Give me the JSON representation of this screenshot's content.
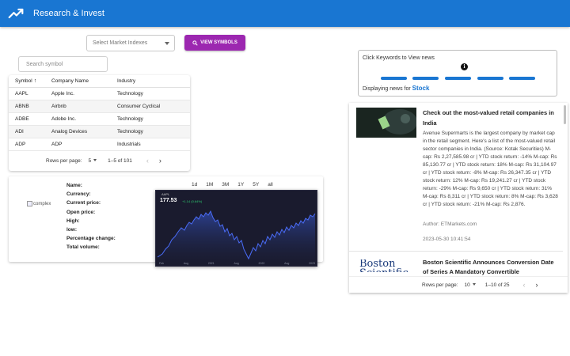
{
  "app": {
    "title": "Research & Invest",
    "brand_color": "#1976d2",
    "logo_icon": "trending-up-icon"
  },
  "controls": {
    "market_select_placeholder": "Select Market Indexes",
    "view_symbols_label": "VIEW SYMBOLS",
    "view_symbols_color": "#9c27b0",
    "search_placeholder": "Search symbol"
  },
  "symbols_table": {
    "headers": {
      "symbol": "Symbol",
      "company": "Company Name",
      "industry": "Industry"
    },
    "sort_icon": "arrow-up-icon",
    "rows": [
      {
        "symbol": "AAPL",
        "company": "Apple Inc.",
        "industry": "Technology"
      },
      {
        "symbol": "ABNB",
        "company": "Airbnb",
        "industry": "Consumer Cyclical"
      },
      {
        "symbol": "ADBE",
        "company": "Adobe Inc.",
        "industry": "Technology"
      },
      {
        "symbol": "ADI",
        "company": "Analog Devices",
        "industry": "Technology"
      },
      {
        "symbol": "ADP",
        "company": "ADP",
        "industry": "Industrials"
      }
    ],
    "pager": {
      "rows_per_page_label": "Rows per page:",
      "rows_per_page": "5",
      "range": "1–5 of 101"
    }
  },
  "stock_detail": {
    "image_alt": "complex",
    "labels": [
      "Name:",
      "Currency:",
      "Current price:",
      "Open price:",
      "High:",
      "low:",
      "Percentage change:",
      "Total volume:"
    ],
    "ranges": [
      "1d",
      "1M",
      "3M",
      "1Y",
      "5Y",
      "all"
    ],
    "chart_image": {
      "ticker": "AAPL",
      "price": "177.53",
      "change": "+1.14 (0.64%)",
      "x_ticks": [
        "Feb",
        "Aug",
        "2021",
        "Aug",
        "2022",
        "Aug",
        "2023"
      ]
    }
  },
  "news_keywords": {
    "title": "Click Keywords to View news",
    "info_icon": "info-icon",
    "displaying_label": "Displaying news for",
    "keyword": "Stock"
  },
  "news": {
    "items": [
      {
        "title": "Check out the most-valued retail companies in India",
        "body": "Avenue Supermarts is the largest company by market cap in the retail segment. Here's a list of the most-valued retail sector companies in India. (Source: Kotak Securities) M-cap: Rs 2,27,585.98 cr | YTD stock return: -14% M-cap: Rs 85,130.77 cr | YTD stock return: 18% M-cap: Rs 31,104.97 cr | YTD stock return: -8% M-cap: Rs 26,347.35 cr | YTD stock return: 12% M-cap: Rs 19,241.27 cr | YTD stock return: -29% M-cap: Rs 9,650 cr | YTD stock return: 31% M-cap: Rs 8,311 cr | YTD stock return: 8% M-cap: Rs 3,628 cr | YTD stock return: -21% M-cap: Rs 2,876.",
        "author": "Author: ETMarkets.com",
        "date": "2023-05-30 10:41:54"
      },
      {
        "title": "Boston Scientific Announces Conversion Date of Series A Mandatory Convertible",
        "logo_text": "Boston Scientific"
      }
    ],
    "pager": {
      "rows_per_page_label": "Rows per page:",
      "rows_per_page": "10",
      "range": "1–10 of 25"
    }
  }
}
